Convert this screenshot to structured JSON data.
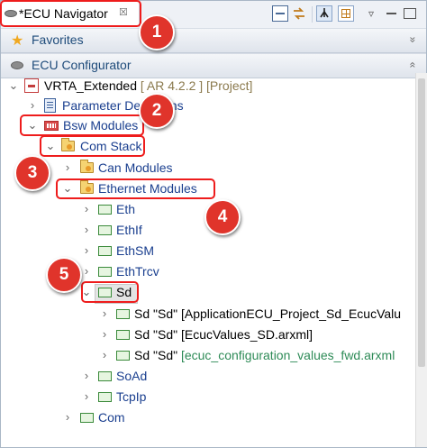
{
  "view": {
    "title": "*ECU Navigator",
    "close_glyph": "☒"
  },
  "toolbar": {
    "icons": [
      "collapse-all-icon",
      "link-with-editor-icon",
      "filter-icon",
      "layout-icon",
      "view-menu-icon",
      "minimize-icon",
      "maximize-icon"
    ],
    "menu_glyph": "▿"
  },
  "sections": {
    "favorites": {
      "title": "Favorites",
      "chevron": "»"
    },
    "configurator": {
      "title": "ECU Configurator",
      "chevron": "«"
    }
  },
  "tree": {
    "root": {
      "label": "VRTA_Extended",
      "suffix": "[ AR 4.2.2 ] [Project]"
    },
    "parameter_definitions": "Parameter Definitions",
    "bsw_modules": "Bsw Modules",
    "com_stack": "Com Stack",
    "can_modules": "Can Modules",
    "ethernet_modules": "Ethernet Modules",
    "eth": "Eth",
    "ethif": "EthIf",
    "ethsm": "EthSM",
    "ethtrcv": "EthTrcv",
    "sd": "Sd",
    "sd_children": [
      {
        "name": "Sd \"Sd\"",
        "file": "[ApplicationECU_Project_Sd_EcucValu",
        "file_color": "#000000"
      },
      {
        "name": "Sd \"Sd\"",
        "file": "[EcucValues_SD.arxml]",
        "file_color": "#000000"
      },
      {
        "name": "Sd \"Sd\"",
        "file": "[ecuc_configuration_values_fwd.arxml",
        "file_color": "#2e8b57"
      }
    ],
    "soad": "SoAd",
    "tcpip": "TcpIp",
    "com": "Com"
  },
  "glyphs": {
    "expanded": "⌄",
    "collapsed": "›",
    "star": "★"
  },
  "annotations": [
    "1",
    "2",
    "3",
    "4",
    "5"
  ],
  "colors": {
    "annotation_red": "#ee1c1c",
    "badge_red": "#e0342b",
    "link_blue": "#1a3f8f",
    "suffix_olive": "#8b7a4e"
  }
}
